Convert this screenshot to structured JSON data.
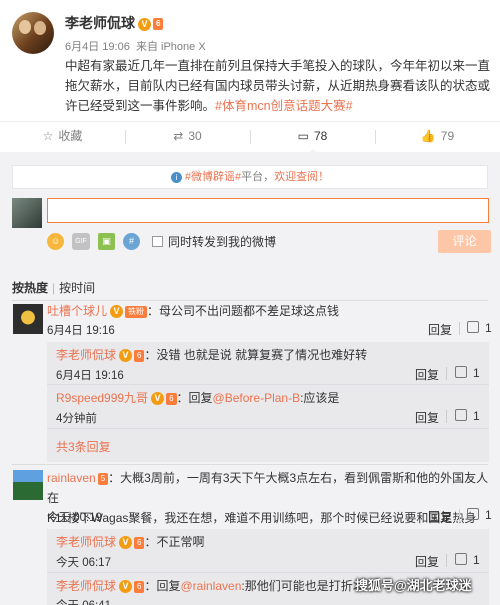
{
  "post": {
    "author": "李老师侃球",
    "verified_badge": "V",
    "level_badge": "6",
    "date": "6月4日 19:06",
    "source": "来自 iPhone X",
    "text_main": "中超有家最近几年一直排在前列且保持大手笔投入的球队，今年年初以来一直拖欠薪水，目前队内已经有国内球员带头讨薪，从近期热身赛看该队的状态或许已经受到这一事件影响。",
    "tag": "#体育mcn创意话题大赛#"
  },
  "actions": {
    "favorite": "收藏",
    "repost_count": "30",
    "comment_count": "78",
    "like_count": "79"
  },
  "notice": {
    "tag": "#微博辟谣#",
    "mid": "平台，",
    "link": "欢迎查阅！"
  },
  "composer": {
    "input_value": "",
    "repost_also": "同时转发到我的微博",
    "submit": "评论"
  },
  "sort": {
    "hot": "按热度",
    "time": "按时间"
  },
  "comments": [
    {
      "user": "吐槽个球儿",
      "text": "：母公司不出问题都不差足球这点钱",
      "time": "6月4日 19:16",
      "reply": "回复",
      "likes": "1",
      "replies": [
        {
          "user": "李老师侃球",
          "text": "：没错 也就是说 就算复赛了情况也难好转",
          "time": "6月4日 19:16",
          "reply": "回复",
          "likes": "1"
        },
        {
          "user": "R9speed999九哥",
          "text": "：回复",
          "mention": "@Before-Plan-B",
          "tail": ":应该是",
          "time": "4分钟前",
          "reply": "回复",
          "likes": "1"
        }
      ],
      "more": "共3条回复"
    },
    {
      "user": "rainlaven",
      "text_line1": "：大概3周前，一周有3天下午大概3点左右，看到佩雷斯和他的外国友人在",
      "text_line2": "K11楼下Wagas聚餐，我还在想，难道不用训练吧，那个时候已经说要和国足热身",
      "time": "今天 00:19",
      "reply": "回复",
      "likes": "1",
      "replies": [
        {
          "user": "李老师侃球",
          "text": "：不正常啊",
          "time": "今天 06:17",
          "reply": "回复",
          "likes": "1"
        },
        {
          "user": "李老师侃球",
          "text": "：回复",
          "mention": "@rainlaven",
          "tail": ":那他们可能也是打折才",
          "time": "今天 06:41",
          "reply": "回复",
          "likes": "1"
        }
      ]
    }
  ],
  "watermark": "搜狐号@湖北老球迷"
}
